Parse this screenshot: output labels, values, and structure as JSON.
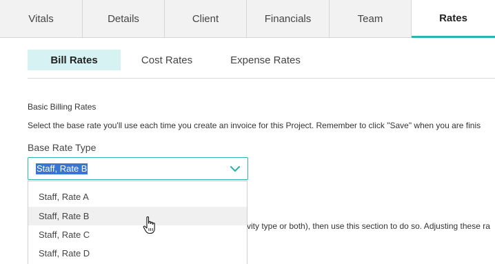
{
  "tabs": [
    {
      "label": "Vitals",
      "active": false
    },
    {
      "label": "Details",
      "active": false
    },
    {
      "label": "Client",
      "active": false
    },
    {
      "label": "Financials",
      "active": false
    },
    {
      "label": "Team",
      "active": false
    },
    {
      "label": "Rates",
      "active": true
    }
  ],
  "subtabs": [
    {
      "label": "Bill Rates",
      "active": true
    },
    {
      "label": "Cost Rates",
      "active": false
    },
    {
      "label": "Expense Rates",
      "active": false
    }
  ],
  "section": {
    "title": "Basic Billing Rates",
    "description": "Select the base rate you'll use each time you create an invoice for this Project. Remember to click \"Save\" when you are finis"
  },
  "base_rate": {
    "label": "Base Rate Type",
    "selected": "Staff, Rate B",
    "options": [
      "Staff, Rate A",
      "Staff, Rate B",
      "Staff, Rate C",
      "Staff, Rate D"
    ],
    "hovered_option": "Staff, Rate B"
  },
  "obscured_text": "vity type or both), then use this section to do so. Adjusting these ra",
  "colors": {
    "accent": "#2cb5b0",
    "subtab_active_bg": "#d7f2f3",
    "selection_highlight": "#3876d6"
  },
  "icons": {
    "select_arrow": "chevron-down-icon",
    "cursor": "hand-pointer-icon"
  }
}
